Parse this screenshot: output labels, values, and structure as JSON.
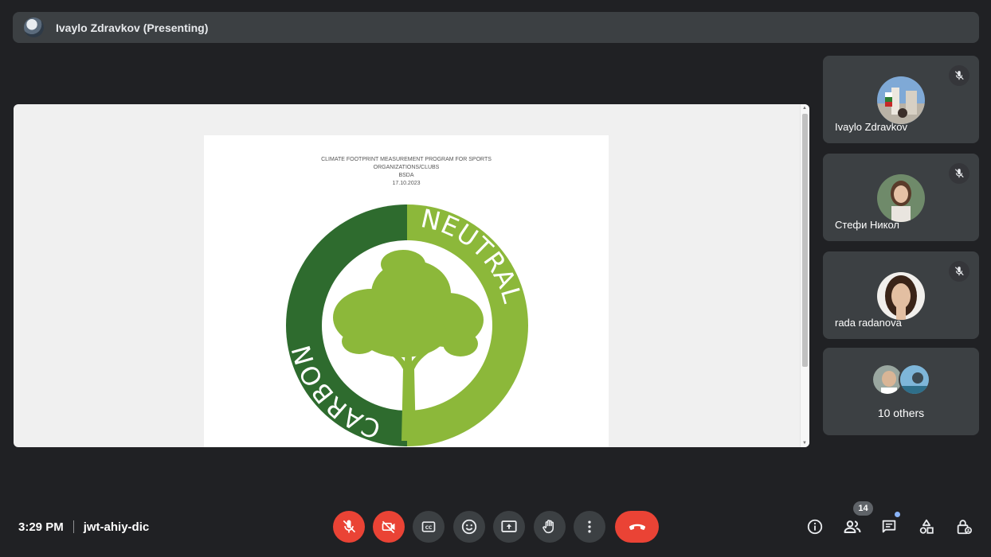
{
  "presenter": {
    "label": "Ivaylo Zdravkov (Presenting)"
  },
  "shared_doc": {
    "heading_lines": [
      "CLIMATE FOOTPRINT MEASUREMENT PROGRAM FOR SPORTS",
      "ORGANIZATIONS/CLUBS",
      "BSDA",
      "17.10.2023"
    ],
    "logo": {
      "left_word": "CARBON",
      "right_word": "NEUTRAL",
      "dark_green": "#2e6b2e",
      "light_green": "#8cb83a"
    }
  },
  "participants": [
    {
      "name": "Ivaylo Zdravkov",
      "muted": true
    },
    {
      "name": "Стефи Никол",
      "muted": true
    },
    {
      "name": "rada radanova",
      "muted": true
    }
  ],
  "others": {
    "label": "10 others"
  },
  "meeting": {
    "time": "3:29 PM",
    "code": "jwt-ahiy-dic"
  },
  "people_count": "14",
  "colors": {
    "background": "#202124",
    "tile": "#3c4043",
    "danger": "#ea4335",
    "accent_dot": "#8ab4f8"
  }
}
